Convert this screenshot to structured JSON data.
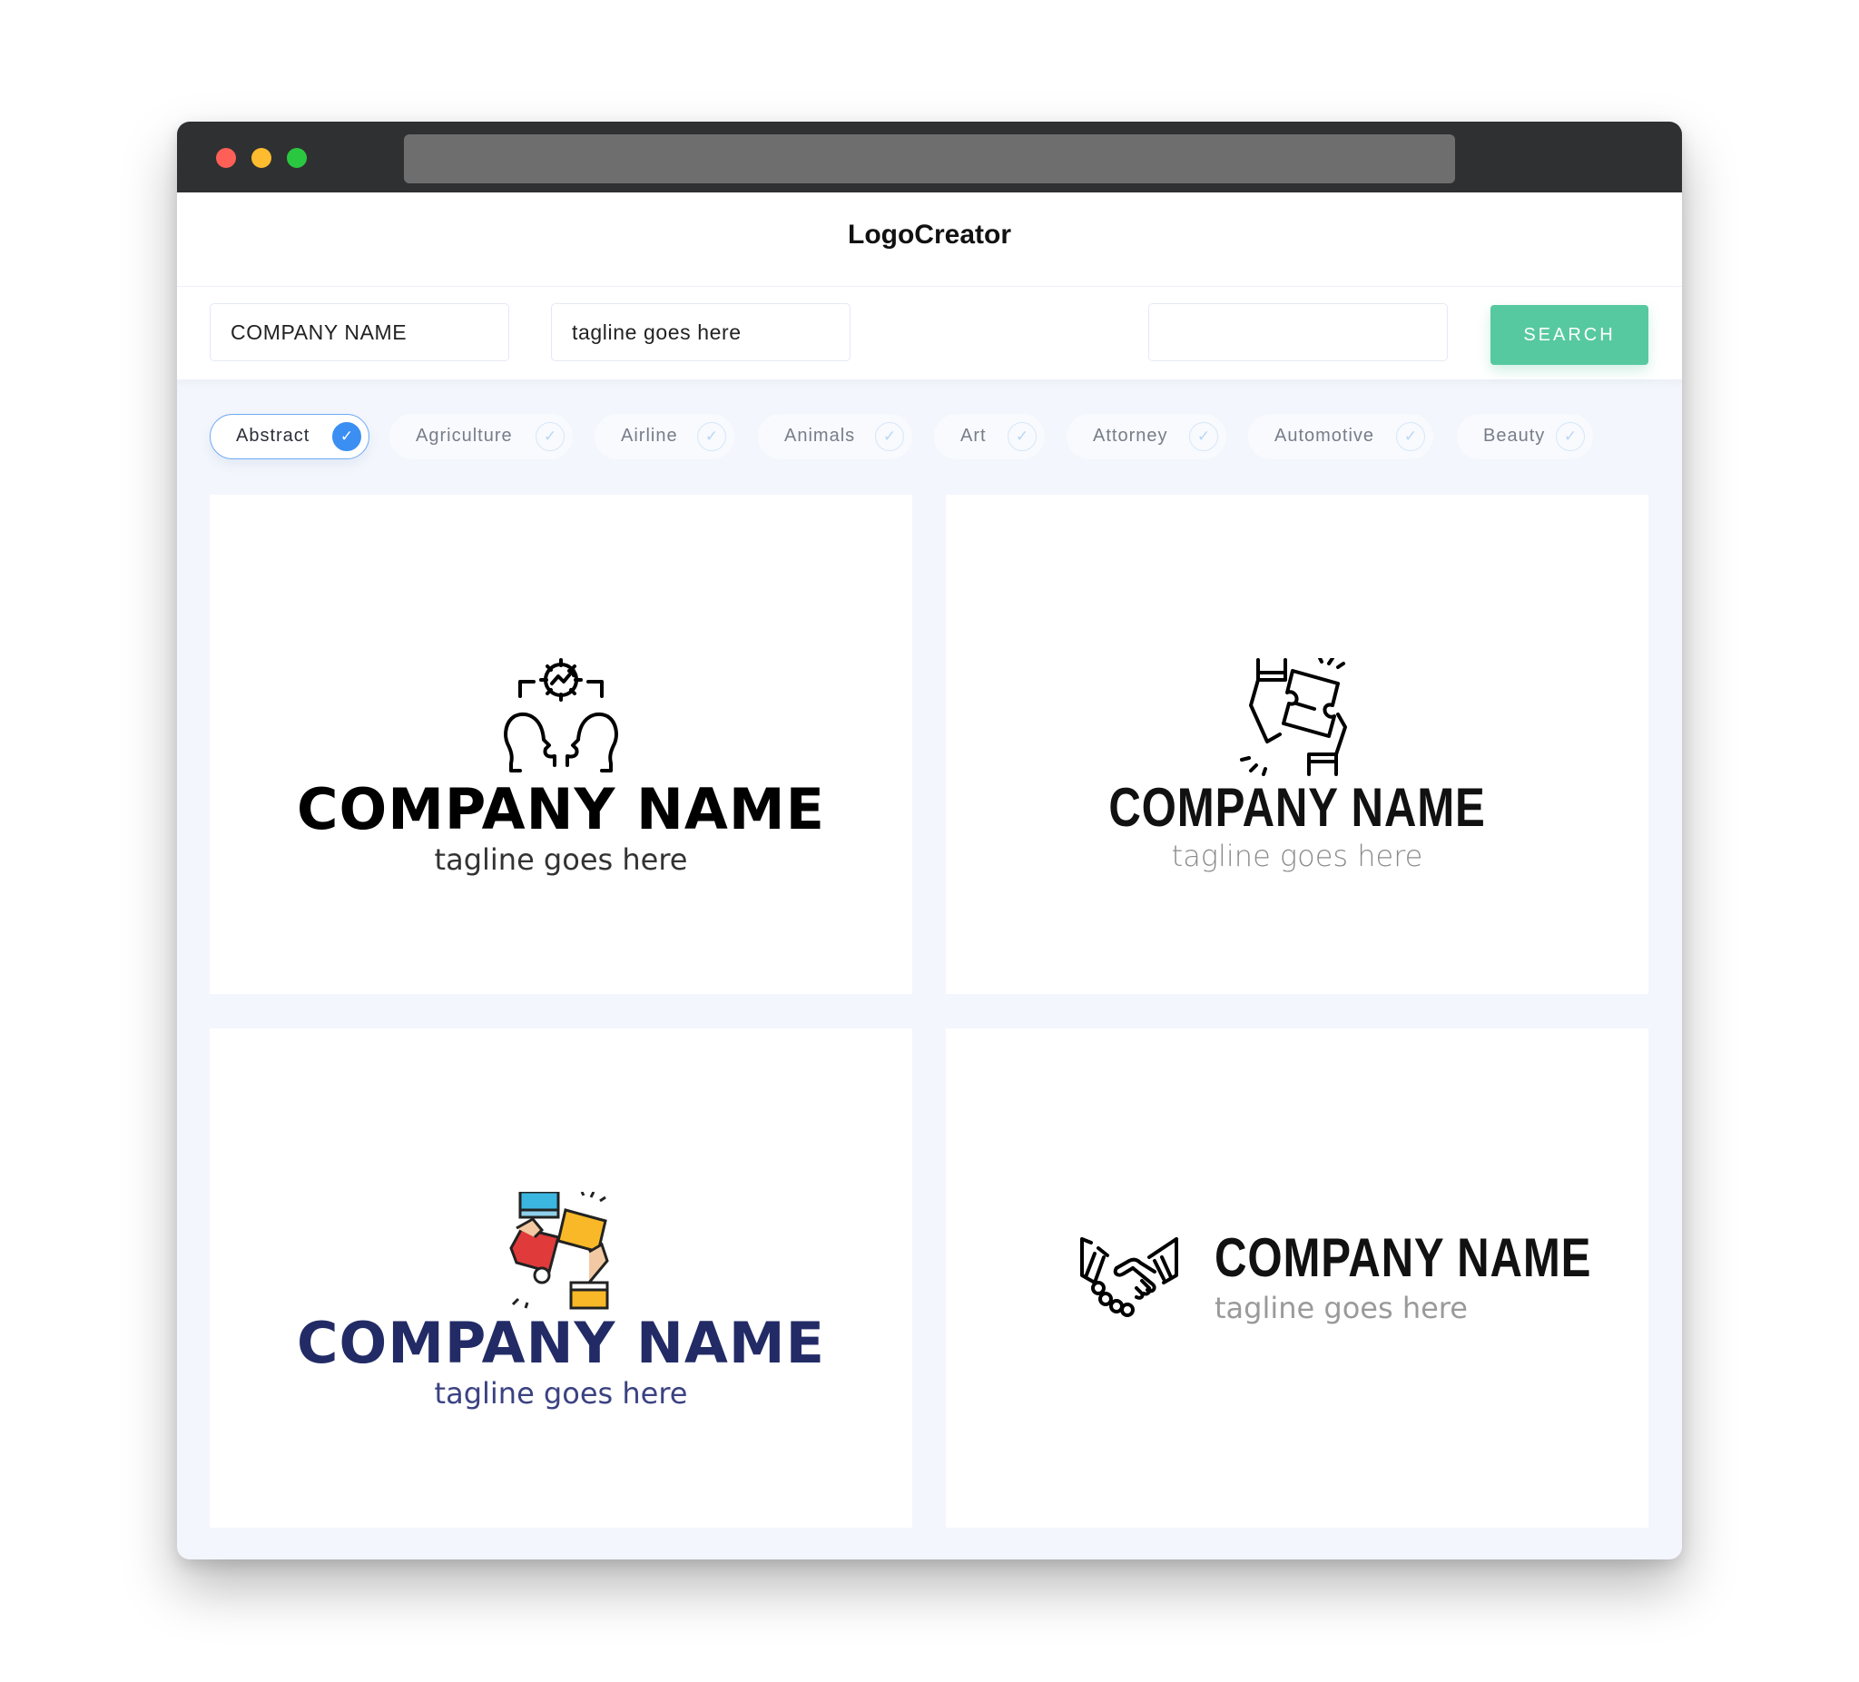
{
  "app": {
    "title": "LogoCreator"
  },
  "search": {
    "company_name_value": "COMPANY NAME",
    "tagline_value": "tagline goes here",
    "extra_value": "",
    "button_label": "SEARCH"
  },
  "categories": [
    {
      "label": "Abstract",
      "selected": true
    },
    {
      "label": "Agriculture",
      "selected": false
    },
    {
      "label": "Airline",
      "selected": false
    },
    {
      "label": "Animals",
      "selected": false
    },
    {
      "label": "Art",
      "selected": false
    },
    {
      "label": "Attorney",
      "selected": false
    },
    {
      "label": "Automotive",
      "selected": false
    },
    {
      "label": "Beauty",
      "selected": false
    }
  ],
  "icons": {
    "check": "✓",
    "next": "→"
  },
  "logos": [
    {
      "icon": "heads-gear-icon",
      "company": "COMPANY NAME",
      "tagline": "tagline goes here",
      "color": "#000000"
    },
    {
      "icon": "puzzle-hands-outline-icon",
      "company": "COMPANY NAME",
      "tagline": "tagline goes here",
      "color": "#111111"
    },
    {
      "icon": "puzzle-hands-color-icon",
      "company": "COMPANY NAME",
      "tagline": "tagline goes here",
      "color": "#222b65"
    },
    {
      "icon": "handshake-icon",
      "company": "COMPANY NAME",
      "tagline": "tagline goes here",
      "color": "#111111"
    }
  ],
  "colors": {
    "accent": "#57c9a0",
    "selected_chip": "#3b8ff3"
  }
}
